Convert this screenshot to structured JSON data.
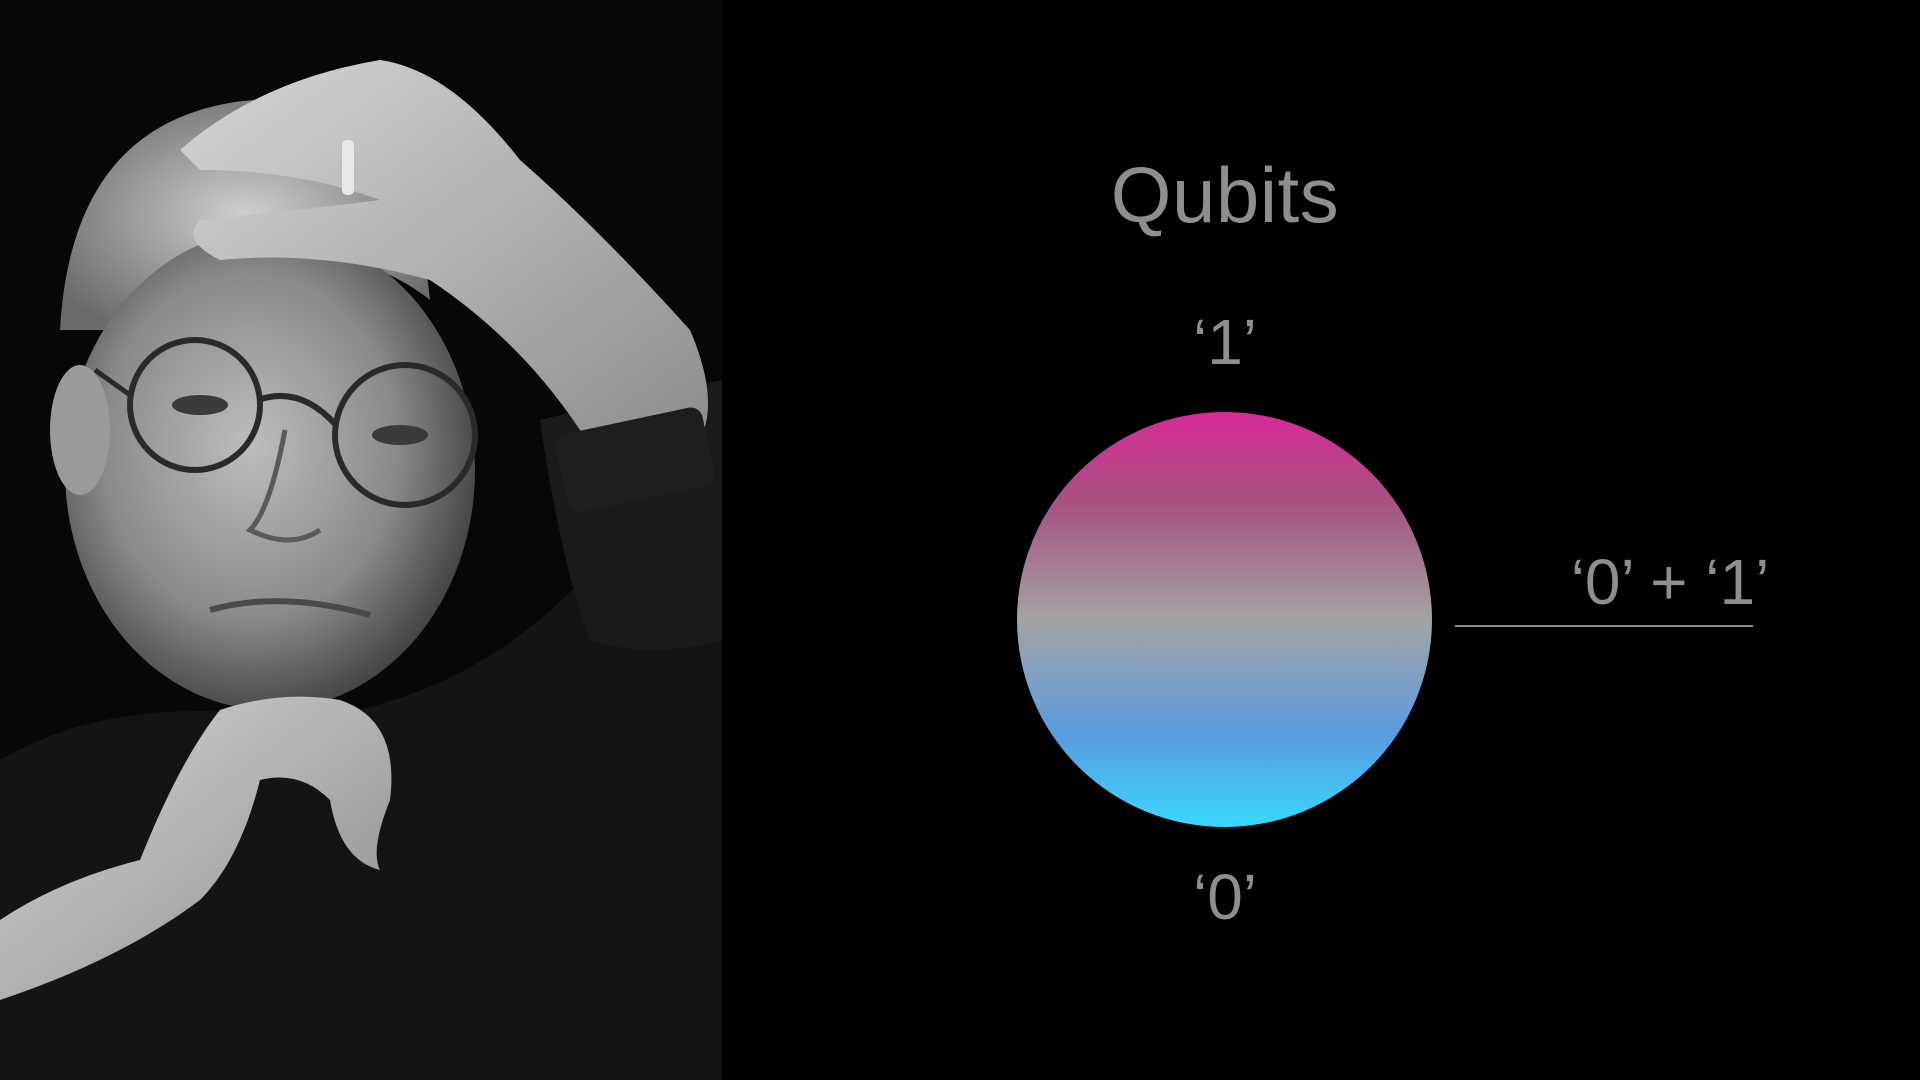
{
  "slide": {
    "title": "Qubits",
    "state_one_label": "‘1’",
    "state_zero_label": "‘0’",
    "superposition_label": "‘0’ + ‘1’"
  },
  "sphere_gradient": {
    "top_color": "#d92a97",
    "upper_color": "#a65280",
    "middle_color": "#a3a3a3",
    "lower_color": "#5a9be0",
    "bottom_color": "#38d8ff"
  },
  "text_color": "#8e8e8e",
  "background_color": "#000000",
  "photo": {
    "style": "black-and-white"
  }
}
